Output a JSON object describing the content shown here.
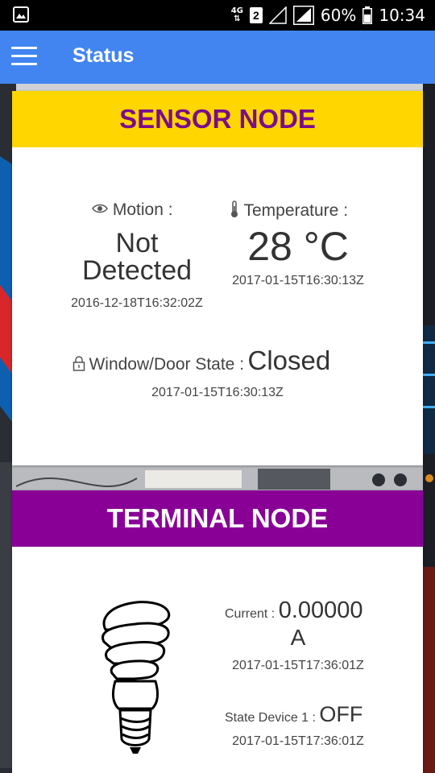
{
  "status_bar": {
    "network_type_top": "4G",
    "network_type_bottom": "⇅",
    "sim_slot": "2",
    "battery_percent": "60%",
    "time": "10:34"
  },
  "app_bar": {
    "title": "Status"
  },
  "sensor_node": {
    "title": "SENSOR NODE",
    "motion": {
      "label": "Motion :",
      "value_line1": "Not",
      "value_line2": "Detected",
      "timestamp": "2016-12-18T16:32:02Z"
    },
    "temperature": {
      "label": "Temperature :",
      "value": "28 °C",
      "timestamp": "2017-01-15T16:30:13Z"
    },
    "window_door": {
      "label": "Window/Door State :",
      "value": "Closed",
      "timestamp": "2017-01-15T16:30:13Z"
    }
  },
  "terminal_node": {
    "title": "TERMINAL NODE",
    "current": {
      "label": "Current :",
      "value": "0.00000",
      "unit": "A",
      "timestamp": "2017-01-15T17:36:01Z"
    },
    "device1": {
      "label": "State Device 1 :",
      "value": "OFF",
      "timestamp": "2017-01-15T17:36:01Z"
    }
  },
  "colors": {
    "app_bar": "#4285f0",
    "sensor_header": "#ffd600",
    "sensor_title": "#7b0d8a",
    "terminal_header": "#880096"
  }
}
